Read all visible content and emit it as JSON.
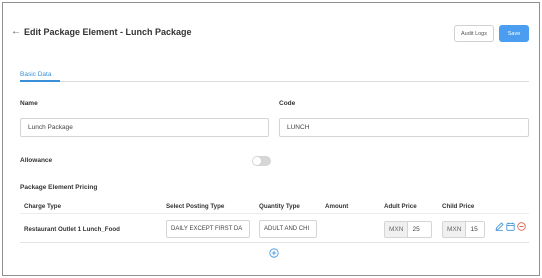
{
  "header": {
    "back_icon": "arrow-left-icon",
    "title": "Edit Package Element - Lunch Package",
    "audit_label": "Audit Logs",
    "save_label": "Save"
  },
  "tabs": [
    {
      "label": "Basic Data",
      "active": true
    }
  ],
  "form": {
    "name_label": "Name",
    "name_value": "Lunch Package",
    "code_label": "Code",
    "code_value": "LUNCH",
    "allowance_label": "Allowance",
    "allowance_on": false
  },
  "pricing": {
    "section_label": "Package Element Pricing",
    "columns": [
      "Charge Type",
      "Select Posting Type",
      "Quantity Type",
      "Amount",
      "Adult Price",
      "Child Price"
    ],
    "rows": [
      {
        "charge_type": "Restaurant Outlet 1 Lunch_Food",
        "posting_type": "DAILY EXCEPT FIRST DA",
        "quantity_type": "ADULT AND CHI",
        "adult_currency": "MXN",
        "adult_price": "25",
        "child_currency": "MXN",
        "child_price": "15"
      }
    ]
  },
  "colors": {
    "accent": "#3a8fd9",
    "save_button": "#4a9df0",
    "delete": "#e05a4f"
  }
}
